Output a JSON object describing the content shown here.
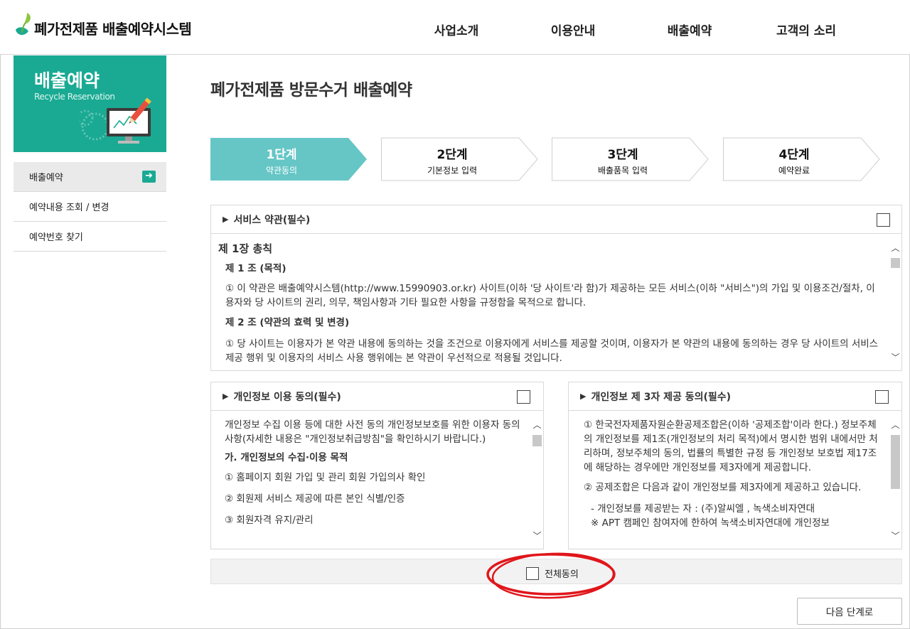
{
  "header": {
    "logo_text": "폐가전제품 배출예약시스템",
    "nav": [
      "사업소개",
      "이용안내",
      "배출예약",
      "고객의 소리"
    ]
  },
  "sidebar": {
    "banner_title": "배출예약",
    "banner_subtitle": "Recycle Reservation",
    "items": [
      {
        "label": "배출예약",
        "active": true,
        "icon": "arrow-right-icon"
      },
      {
        "label": "예약내용 조회 / 변경"
      },
      {
        "label": "예약번호 찾기"
      }
    ]
  },
  "main": {
    "title": "폐가전제품 방문수거 배출예약",
    "steps": [
      {
        "step": "1단계",
        "label": "약관동의",
        "active": true
      },
      {
        "step": "2단계",
        "label": "기본정보 입력"
      },
      {
        "step": "3단계",
        "label": "배출품목 입력"
      },
      {
        "step": "4단계",
        "label": "예약완료"
      }
    ],
    "terms": {
      "title": "서비스 약관(필수)",
      "chapter": "제 1장 총칙",
      "art1_title": "제 1 조 (목적)",
      "art1_text": "① 이 약관은 배출예약시스템(http://www.15990903.or.kr) 사이트(이하 '당 사이트'라 함)가 제공하는 모든 서비스(이하 \"서비스\")의 가입 및 이용조건/절차, 이용자와 당 사이트의 권리, 의무, 책임사항과 기타 필요한 사항을 규정함을 목적으로 합니다.",
      "art2_title": "제 2 조 (약관의 효력 및 변경)",
      "art2_text": "① 당 사이트는 이용자가 본 약관 내용에 동의하는 것을 조건으로 이용자에게 서비스를 제공할 것이며, 이용자가 본 약관의 내용에 동의하는 경우 당 사이트의 서비스 제공 행위 및 이용자의 서비스 사용 행위에는 본 약관이 우선적으로 적용될 것입니다."
    },
    "privacy": {
      "title": "개인정보 이용 동의(필수)",
      "intro": "개인정보 수집 이용 등에 대한 사전 동의 개인정보보호를 위한 이용자 동의사항(자세한 내용은 \"개인정보취급방침\"을 확인하시기 바랍니다.)",
      "section": "가. 개인정보의 수집·이용 목적",
      "items": [
        "① 홈페이지 회원 가입 및 관리 회원 가입의사 확인",
        "② 회원제 서비스 제공에 따른 본인 식별/인증",
        "③ 회원자격 유지/관리"
      ]
    },
    "third_party": {
      "title": "개인정보 제 3자 제공 동의(필수)",
      "p1": "① 한국전자제품자원순환공제조합은(이하 '공제조합'이라 한다.) 정보주체의 개인정보를 제1조(개인정보의 처리 목적)에서 명시한 범위 내에서만 처리하며, 정보주체의 동의, 법률의 특별한 규정 등 개인정보 보호법 제17조에 해당하는 경우에만 개인정보를 제3자에게 제공합니다.",
      "p2": "② 공제조합은 다음과 같이 개인정보를 제3자에게 제공하고 있습니다.",
      "p3": "- 개인정보를 제공받는 자 : (주)알씨엘 , 녹색소비자연대",
      "p4": "※ APT 캠페인 참여자에 한하여 녹색소비자연대에 개인정보"
    },
    "agree_all": "전체동의",
    "next_button": "다음 단계로"
  },
  "colors": {
    "accent": "#1aaa93",
    "step_active": "#66c6c6",
    "annotation_ring": "#e0161b"
  }
}
